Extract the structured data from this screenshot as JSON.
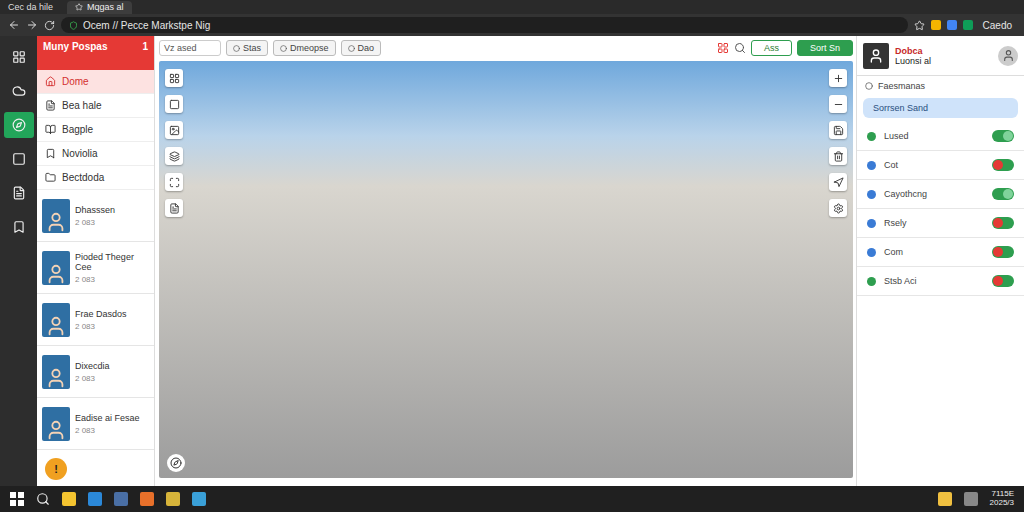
{
  "browser": {
    "window_title": "Cec da hile",
    "tab": "Mqgas al",
    "address": "Ocem // Pecce Markstpe Nig",
    "profile": "Caedo"
  },
  "rail": [
    {
      "selected": false
    },
    {
      "selected": false
    },
    {
      "selected": true
    },
    {
      "selected": false
    },
    {
      "selected": false
    },
    {
      "selected": false
    }
  ],
  "sidebar": {
    "title": "Muny Pospas",
    "badge": "1",
    "alert": "!",
    "items": [
      {
        "label": "Dome",
        "selected": true
      },
      {
        "label": "Bea hale",
        "selected": false
      },
      {
        "label": "Bagple",
        "selected": false
      },
      {
        "label": "Noviolia",
        "selected": false
      },
      {
        "label": "Bectdoda",
        "selected": false
      }
    ],
    "contacts": [
      {
        "name": "Dhasssen",
        "meta": "2 083"
      },
      {
        "name": "Pioded Theger Cee",
        "meta": "2 083"
      },
      {
        "name": "Frae Dasdos",
        "meta": "2 083"
      },
      {
        "name": "Dixecdia",
        "meta": "2 083"
      },
      {
        "name": "Eadise ai Fesae",
        "meta": "2 083"
      }
    ]
  },
  "toolbar": {
    "search": "Vz ased",
    "buttons": [
      "Stas",
      "Dmeopse",
      "Dao"
    ],
    "actions": [
      {
        "label": "Ass",
        "kind": "outline"
      },
      {
        "label": "Sort Sn",
        "kind": "filled"
      }
    ]
  },
  "panel": {
    "user": {
      "name": "Dobca",
      "sub": "Luonsi al"
    },
    "title": "Faesmanas",
    "search": "Sorrsen Sand",
    "rows": [
      {
        "label": "Lused",
        "on": true,
        "color": "#2e9e4f"
      },
      {
        "label": "Cot",
        "on": false,
        "color": "#3a7bd5"
      },
      {
        "label": "Cayothcng",
        "on": true,
        "color": "#3a7bd5"
      },
      {
        "label": "Rsely",
        "on": false,
        "color": "#3a7bd5"
      },
      {
        "label": "Com",
        "on": false,
        "color": "#3a7bd5"
      },
      {
        "label": "Stsb Aci",
        "on": false,
        "color": "#2e9e4f"
      }
    ]
  },
  "taskbar": {
    "time": "7115E",
    "date": "2025/3"
  }
}
